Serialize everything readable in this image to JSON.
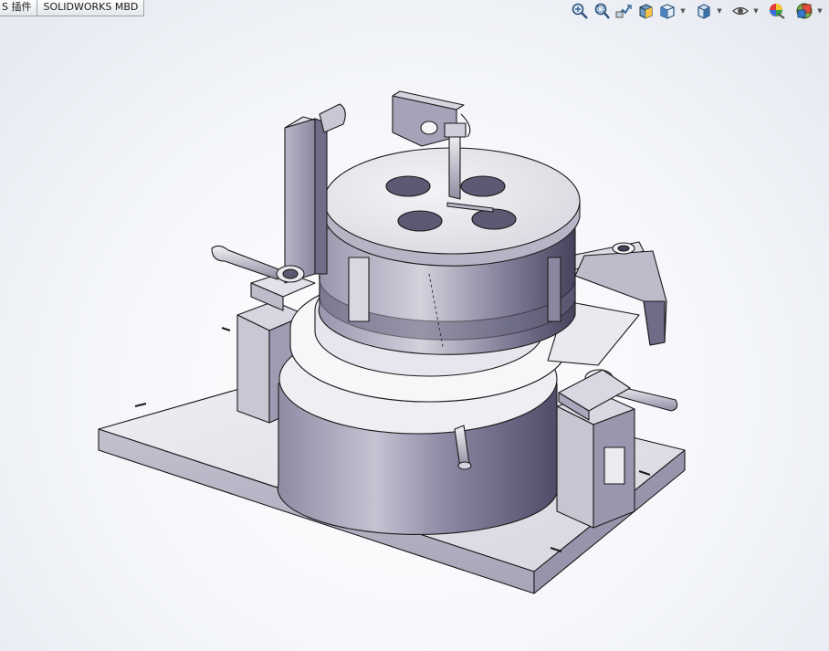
{
  "command_tabs": [
    {
      "label": "S 插件"
    },
    {
      "label": "SOLIDWORKS MBD"
    }
  ],
  "heads_up_toolbar": [
    {
      "icon": "zoom-to-fit-icon",
      "has_dropdown": false
    },
    {
      "icon": "zoom-to-area-icon",
      "has_dropdown": false
    },
    {
      "icon": "previous-view-icon",
      "has_dropdown": false
    },
    {
      "icon": "section-view-icon",
      "has_dropdown": false
    },
    {
      "icon": "view-orientation-icon",
      "has_dropdown": true
    },
    {
      "icon": "display-style-icon",
      "has_dropdown": true
    },
    {
      "icon": "hide-show-items-icon",
      "has_dropdown": true
    },
    {
      "icon": "edit-appearance-icon",
      "has_dropdown": false
    },
    {
      "icon": "apply-scene-icon",
      "has_dropdown": true
    }
  ],
  "graphics_area": {
    "model": "fixture-assembly-3d-model",
    "colors": {
      "background_center": "#ffffff",
      "background_edge": "#e4e8ef",
      "part_light": "#e9e9ee",
      "part_mid": "#b9b8c6",
      "part_dark": "#5a5873",
      "edge": "#1a1a1a"
    }
  }
}
